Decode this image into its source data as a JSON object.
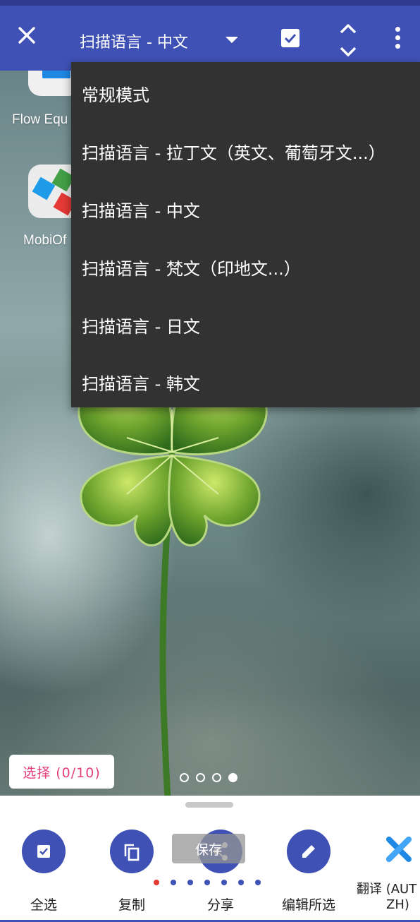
{
  "topbar": {
    "title": "扫描语言 - 中文",
    "close_icon": "close-icon",
    "dropdown_icon": "caret-down-icon",
    "select_icon": "checkbox-icon",
    "expand_icon": "unfold-icon",
    "more_icon": "more-vert-icon",
    "color": "#3f51b5"
  },
  "background_apps": [
    {
      "label": "Flow Equ"
    },
    {
      "label": "MobiOf"
    }
  ],
  "menu": {
    "items": [
      {
        "label": "常规模式"
      },
      {
        "label": "扫描语言 - 拉丁文（英文、葡萄牙文...）"
      },
      {
        "label": "扫描语言 - 中文"
      },
      {
        "label": "扫描语言 - 梵文（印地文...）"
      },
      {
        "label": "扫描语言 - 日文"
      },
      {
        "label": "扫描语言 - 韩文"
      }
    ],
    "background": "#323232"
  },
  "selection_chip": {
    "label": "选择 (0/10)",
    "color": "#e4407e"
  },
  "page_indicator": {
    "count": 4,
    "active_index": 3
  },
  "bottom_sheet": {
    "actions": [
      {
        "label": "全选",
        "icon": "checkbox-icon"
      },
      {
        "label": "复制",
        "icon": "copy-icon"
      },
      {
        "label": "分享",
        "icon": "share-icon"
      },
      {
        "label": "编辑所选",
        "icon": "pencil-icon"
      }
    ],
    "save_overlay": "保存",
    "translate": {
      "label_line1": "翻译 (AUT",
      "label_line2": "ZH)",
      "icon": "translate-x-icon"
    },
    "carousel_dots": {
      "count": 7,
      "active_index": 0
    }
  }
}
